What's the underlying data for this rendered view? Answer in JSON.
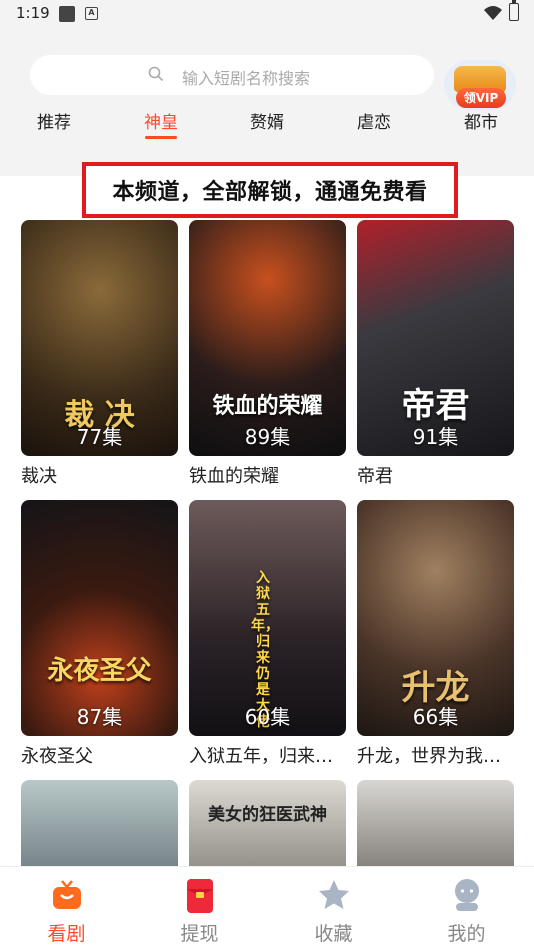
{
  "status_bar": {
    "time": "1:19",
    "notif_glyph": "A"
  },
  "search": {
    "placeholder": "输入短剧名称搜索"
  },
  "vip_badge": {
    "label": "领VIP"
  },
  "tabs": [
    {
      "label": "推荐",
      "active": false
    },
    {
      "label": "神皇",
      "active": true
    },
    {
      "label": "赘婿",
      "active": false
    },
    {
      "label": "虐恋",
      "active": false
    },
    {
      "label": "都市",
      "active": false
    }
  ],
  "banner": {
    "text": "本频道，全部解锁，通通免费看"
  },
  "dramas": [
    {
      "title": "裁决",
      "episodes": "77集",
      "poster_text": "裁 决"
    },
    {
      "title": "铁血的荣耀",
      "episodes": "89集",
      "poster_text": "铁血的荣耀"
    },
    {
      "title": "帝君",
      "episodes": "91集",
      "poster_text": "帝君"
    },
    {
      "title": "永夜圣父",
      "episodes": "87集",
      "poster_text": "永夜圣父"
    },
    {
      "title": "入狱五年，归来仍是大佬",
      "episodes": "60集",
      "poster_text": "入狱五年，归来仍是大佬"
    },
    {
      "title": "升龙，世界为我所用",
      "episodes": "66集",
      "poster_text": "升龙"
    },
    {
      "title": "",
      "episodes": "",
      "poster_text": ""
    },
    {
      "title": "",
      "episodes": "",
      "poster_text": "美女的狂医武神"
    },
    {
      "title": "",
      "episodes": "",
      "poster_text": ""
    }
  ],
  "bottom_nav": [
    {
      "label": "看剧",
      "icon": "tv-icon",
      "active": true
    },
    {
      "label": "提现",
      "icon": "red-envelope-icon",
      "active": false
    },
    {
      "label": "收藏",
      "icon": "star-icon",
      "active": false
    },
    {
      "label": "我的",
      "icon": "profile-icon",
      "active": false
    }
  ],
  "colors": {
    "accent": "#ff4a2a",
    "banner_border": "#e11b1b"
  }
}
